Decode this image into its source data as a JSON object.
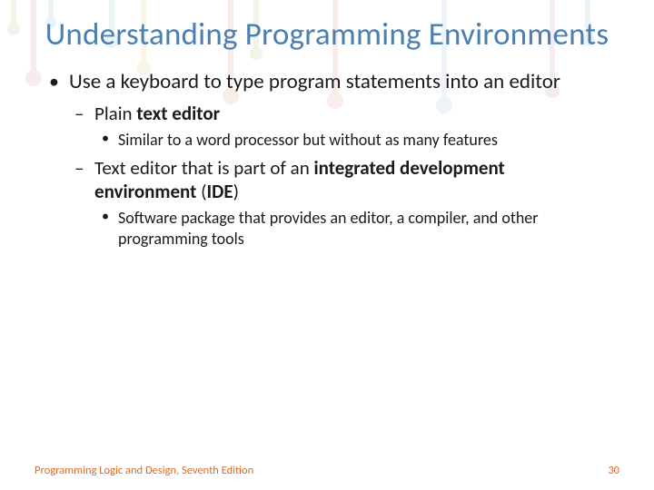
{
  "title": "Understanding Programming Environments",
  "bullets": {
    "item1": "Use a keyboard to type program statements into an editor",
    "item1a_prefix": "Plain ",
    "item1a_bold": "text editor",
    "item1a_i": "Similar to a word processor but without as many features",
    "item1b_prefix": "Text editor that is part of an ",
    "item1b_bold1": "integrated development environment",
    "item1b_paren_open": " (",
    "item1b_bold2": "IDE",
    "item1b_paren_close": ")",
    "item1b_i": "Software package that provides an editor, a compiler, and other programming tools"
  },
  "footer": {
    "book": "Programming Logic and Design, Seventh Edition",
    "page": "30"
  }
}
